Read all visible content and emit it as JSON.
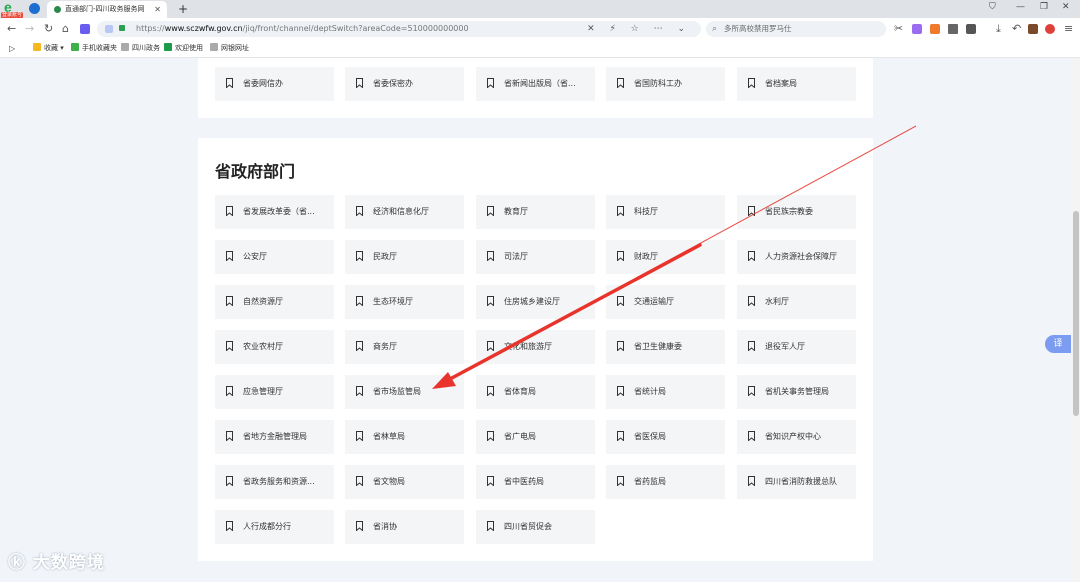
{
  "browser": {
    "logo_badge": "登录账号",
    "tab_title": "直通部门-四川政务服务网",
    "new_tab_label": "+",
    "url_scheme": "https://",
    "url_domain": "www.sczwfw.gov.cn",
    "url_path": "/jiq/front/channel/deptSwitch?areaCode=510000000000",
    "search_text": "多所高校禁用罗马仕",
    "bookmarks": [
      "收藏",
      "手机收藏夹",
      "四川政务",
      "欢迎使用",
      "网银网址"
    ]
  },
  "page": {
    "section1_items": [
      "省委网信办",
      "省委保密办",
      "省新闻出版局（省...",
      "省国防科工办",
      "省档案局"
    ],
    "section2_title": "省政府部门",
    "section2_items": [
      "省发展改革委（省...",
      "经济和信息化厅",
      "教育厅",
      "科技厅",
      "省民族宗教委",
      "公安厅",
      "民政厅",
      "司法厅",
      "财政厅",
      "人力资源社会保障厅",
      "自然资源厅",
      "生态环境厅",
      "住房城乡建设厅",
      "交通运输厅",
      "水利厅",
      "农业农村厅",
      "商务厅",
      "文化和旅游厅",
      "省卫生健康委",
      "退役军人厅",
      "应急管理厅",
      "省市场监管局",
      "省体育局",
      "省统计局",
      "省机关事务管理局",
      "省地方金融管理局",
      "省林草局",
      "省广电局",
      "省医保局",
      "省知识产权中心",
      "省政务服务和资源...",
      "省文物局",
      "省中医药局",
      "省药监局",
      "四川省消防救援总队",
      "人行成都分行",
      "省消协",
      "四川省贸促会"
    ],
    "float_button": "译",
    "watermark": "大数跨境"
  },
  "colors": {
    "annotation_arrow": "#e8342c",
    "accent_green": "#22a84a",
    "float_button": "#7b9cf0"
  }
}
